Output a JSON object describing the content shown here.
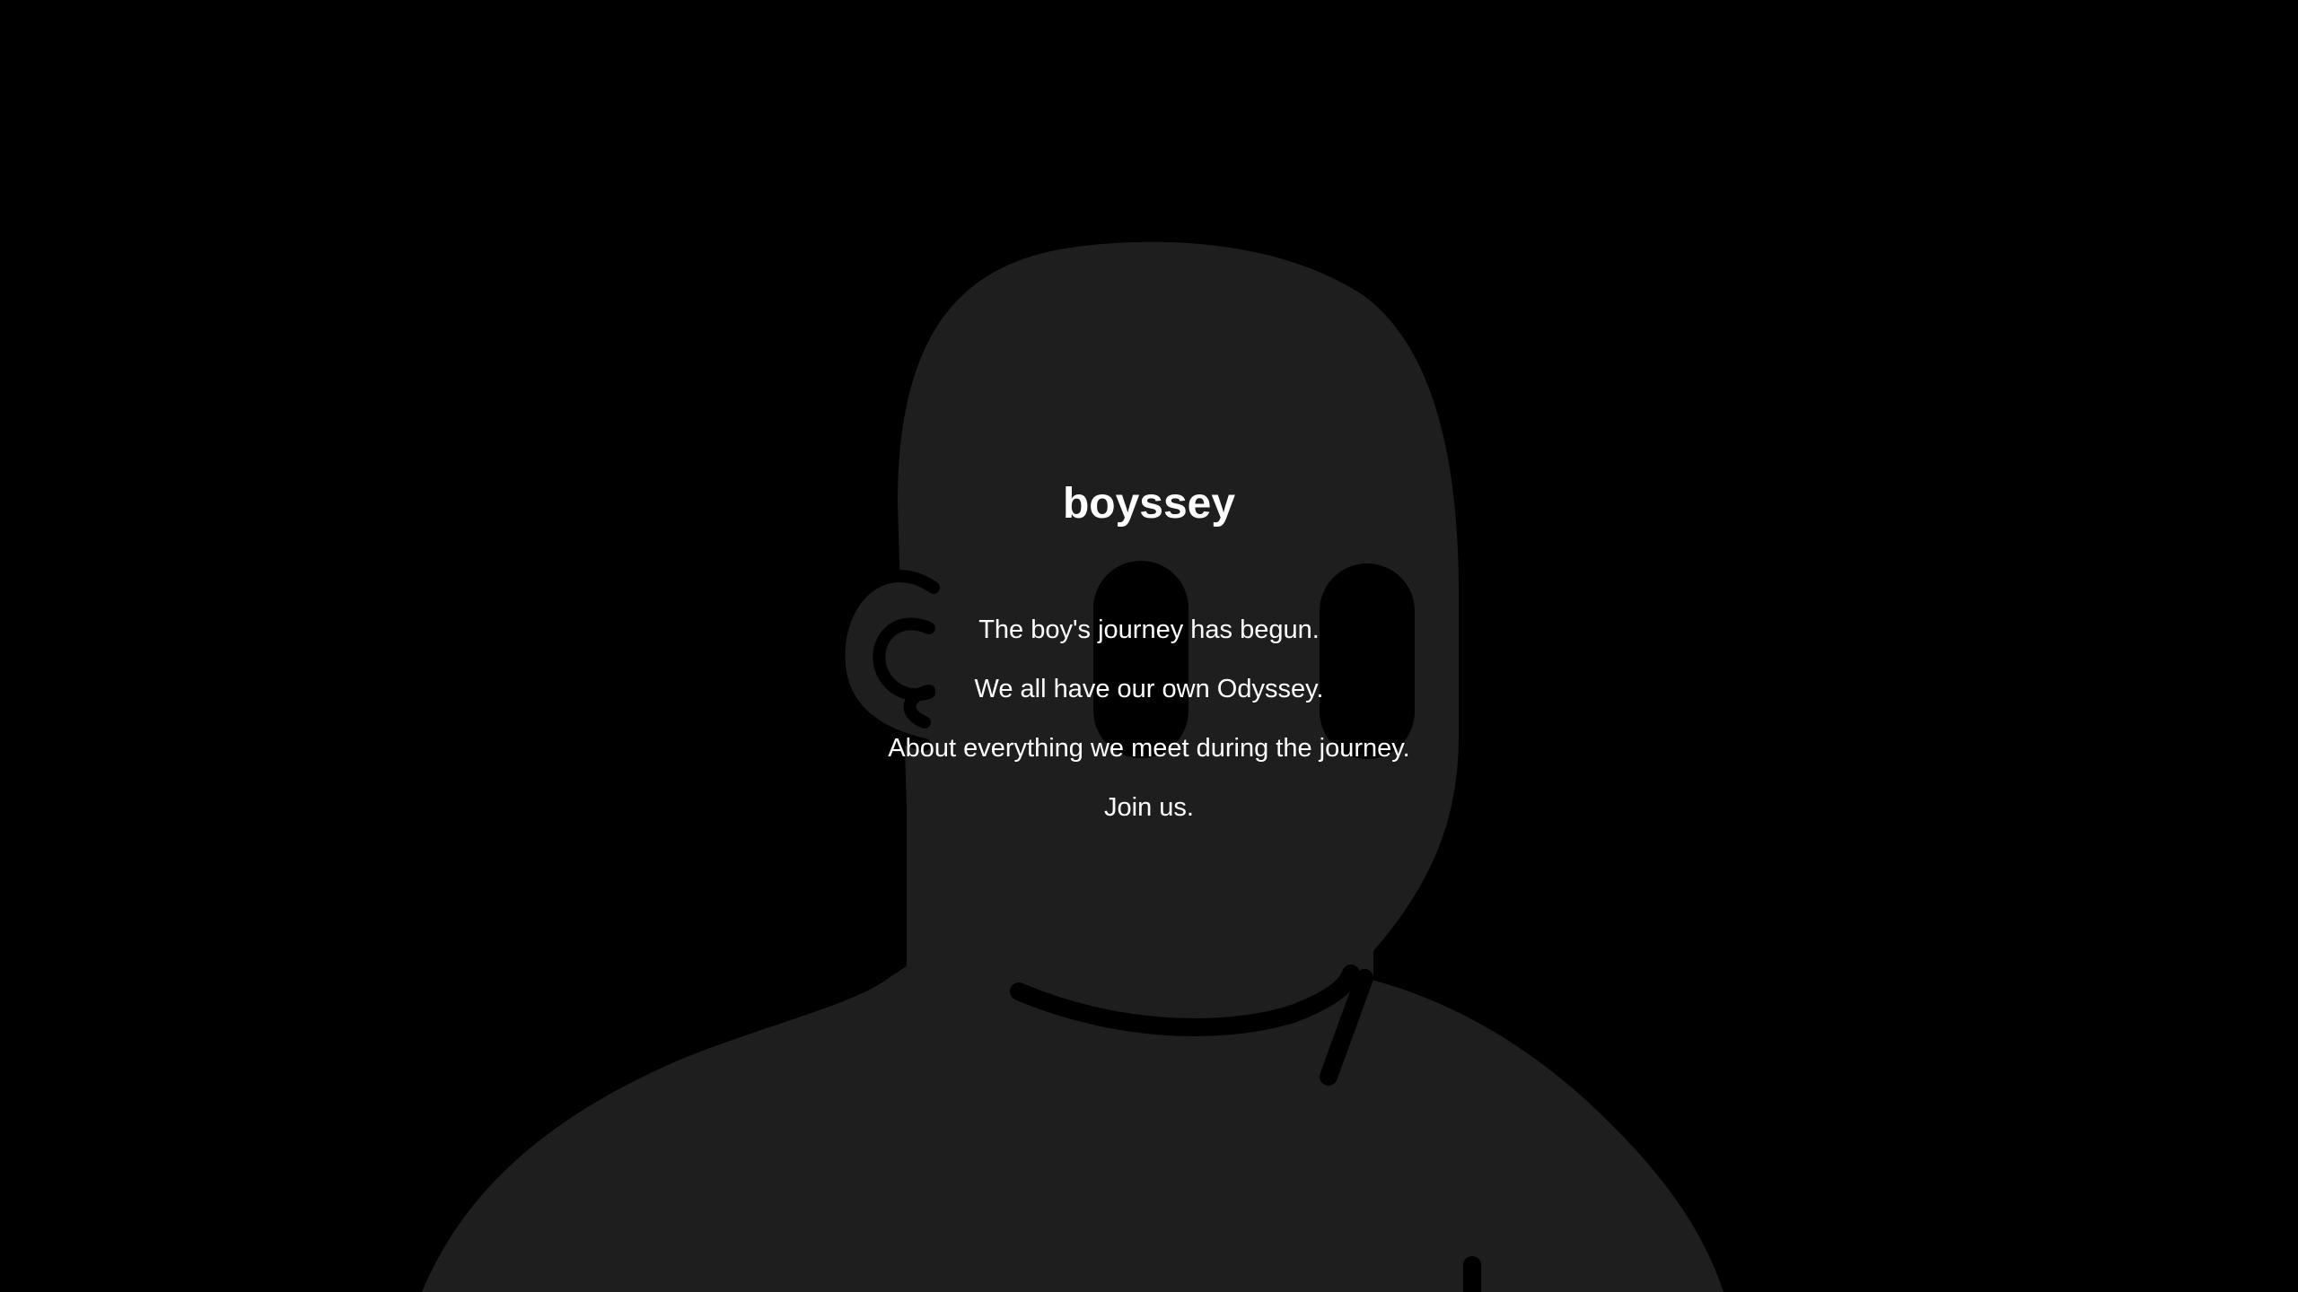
{
  "colors": {
    "background": "#000000",
    "figure_fill": "#1e1e1e",
    "text": "#ffffff"
  },
  "illustration": "boy-silhouette",
  "hero": {
    "title": "boyssey",
    "lines": [
      "The boy's journey has begun.",
      "We all have our own Odyssey.",
      "About everything we meet during the journey.",
      "Join us."
    ]
  }
}
